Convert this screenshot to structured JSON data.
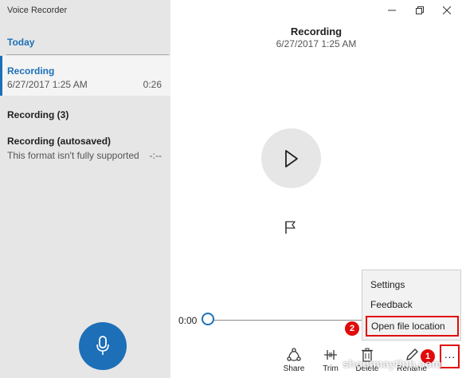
{
  "app": {
    "title": "Voice Recorder"
  },
  "sidebar": {
    "group_header": "Today",
    "items": [
      {
        "title": "Recording",
        "date": "6/27/2017 1:25 AM",
        "duration": "0:26",
        "selected": true
      },
      {
        "title": "Recording (3)"
      },
      {
        "title": "Recording (autosaved)",
        "subtitle": "This format isn't fully supported",
        "duration": "-:--"
      }
    ],
    "record_icon": "microphone-icon"
  },
  "window_controls": [
    "minimize-icon",
    "maximize-icon",
    "close-icon"
  ],
  "detail": {
    "title": "Recording",
    "date": "6/27/2017 1:25 AM",
    "play_icon": "play-icon",
    "marker_icon": "flag-icon"
  },
  "playback": {
    "current_time": "0:00",
    "progress": 0
  },
  "toolbar": {
    "share_label": "Share",
    "trim_label": "Trim",
    "delete_label": "Delete",
    "rename_label": "Rename",
    "more_label": "···"
  },
  "menu": {
    "items": [
      "Settings",
      "Feedback",
      "Open file location"
    ]
  },
  "annotations": {
    "badge_1": "1",
    "badge_2": "2"
  },
  "watermark": "shoutmaytinh.com",
  "colors": {
    "accent": "#1d6fb8",
    "highlight": "#e10b0b",
    "sidebar_bg": "#e6e6e6"
  }
}
